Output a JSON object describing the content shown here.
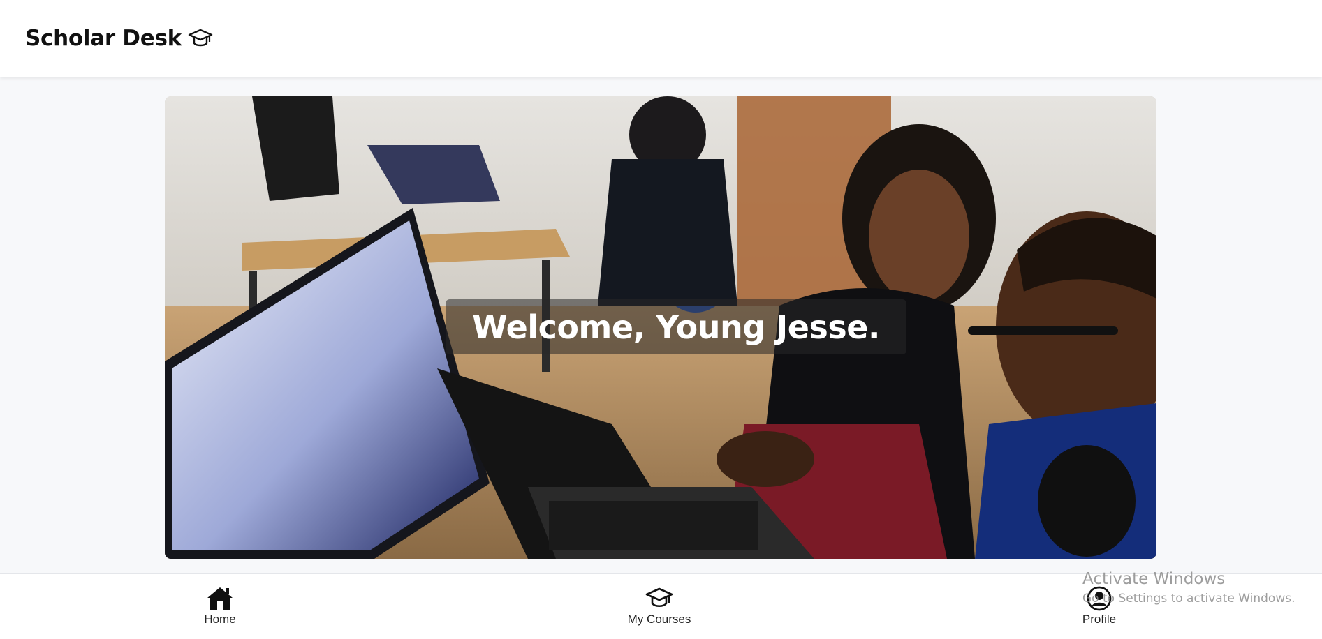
{
  "header": {
    "title": "Scholar Desk",
    "logo_icon": "graduation-cap-icon"
  },
  "hero": {
    "welcome_text": "Welcome, Young Jesse."
  },
  "bottom_nav": {
    "items": [
      {
        "label": "Home",
        "icon": "home-icon"
      },
      {
        "label": "My Courses",
        "icon": "graduation-cap-icon"
      },
      {
        "label": "Profile",
        "icon": "user-circle-icon"
      }
    ]
  },
  "watermark": {
    "title": "Activate Windows",
    "subtitle": "Go to Settings to activate Windows."
  }
}
